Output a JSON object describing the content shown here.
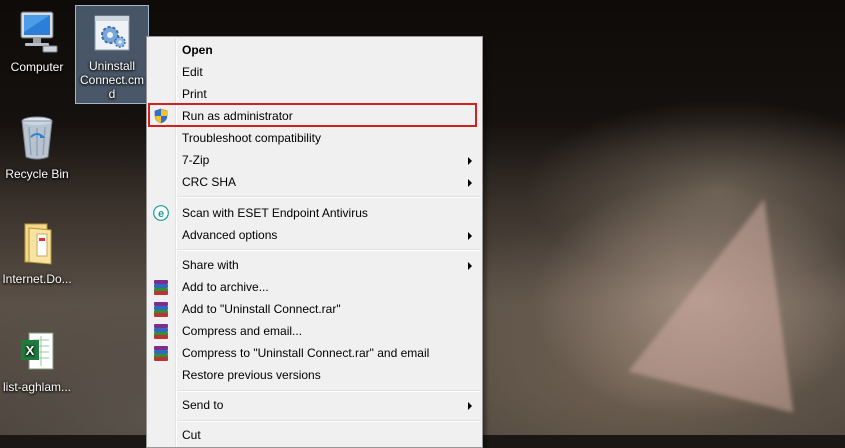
{
  "desktop": {
    "icons": [
      {
        "label": "Computer",
        "icon": "computer-icon"
      },
      {
        "label": "Uninstall Connect.cmd",
        "label_lines": [
          "Uninstall",
          "Connect.cm",
          "d"
        ],
        "icon": "cmd-gear-icon",
        "selected": true
      },
      {
        "label": "Recycle Bin",
        "icon": "recycle-bin-icon"
      },
      {
        "label": "Internet.Do...",
        "icon": "folder-icon"
      },
      {
        "label": "list-aghlam...",
        "icon": "excel-icon"
      }
    ]
  },
  "context_menu": {
    "items": [
      {
        "label": "Open",
        "bold": true
      },
      {
        "label": "Edit"
      },
      {
        "label": "Print"
      },
      {
        "label": "Run as administrator",
        "icon": "uac-shield-icon",
        "highlighted": true
      },
      {
        "label": "Troubleshoot compatibility"
      },
      {
        "label": "7-Zip",
        "submenu": true
      },
      {
        "label": "CRC SHA",
        "submenu": true
      },
      {
        "label": "Scan with ESET Endpoint Antivirus",
        "icon": "eset-icon"
      },
      {
        "label": "Advanced options",
        "submenu": true
      },
      {
        "label": "Share with",
        "submenu": true
      },
      {
        "label": "Add to archive...",
        "icon": "winrar-icon"
      },
      {
        "label": "Add to \"Uninstall Connect.rar\"",
        "icon": "winrar-icon"
      },
      {
        "label": "Compress and email...",
        "icon": "winrar-icon"
      },
      {
        "label": "Compress to \"Uninstall Connect.rar\" and email",
        "icon": "winrar-icon"
      },
      {
        "label": "Restore previous versions"
      },
      {
        "label": "Send to",
        "submenu": true
      },
      {
        "label": "Cut"
      }
    ]
  },
  "colors": {
    "highlight_border": "#d21f1f",
    "menu_background": "#f0f0f0",
    "eset_teal": "#1a9e9a"
  }
}
